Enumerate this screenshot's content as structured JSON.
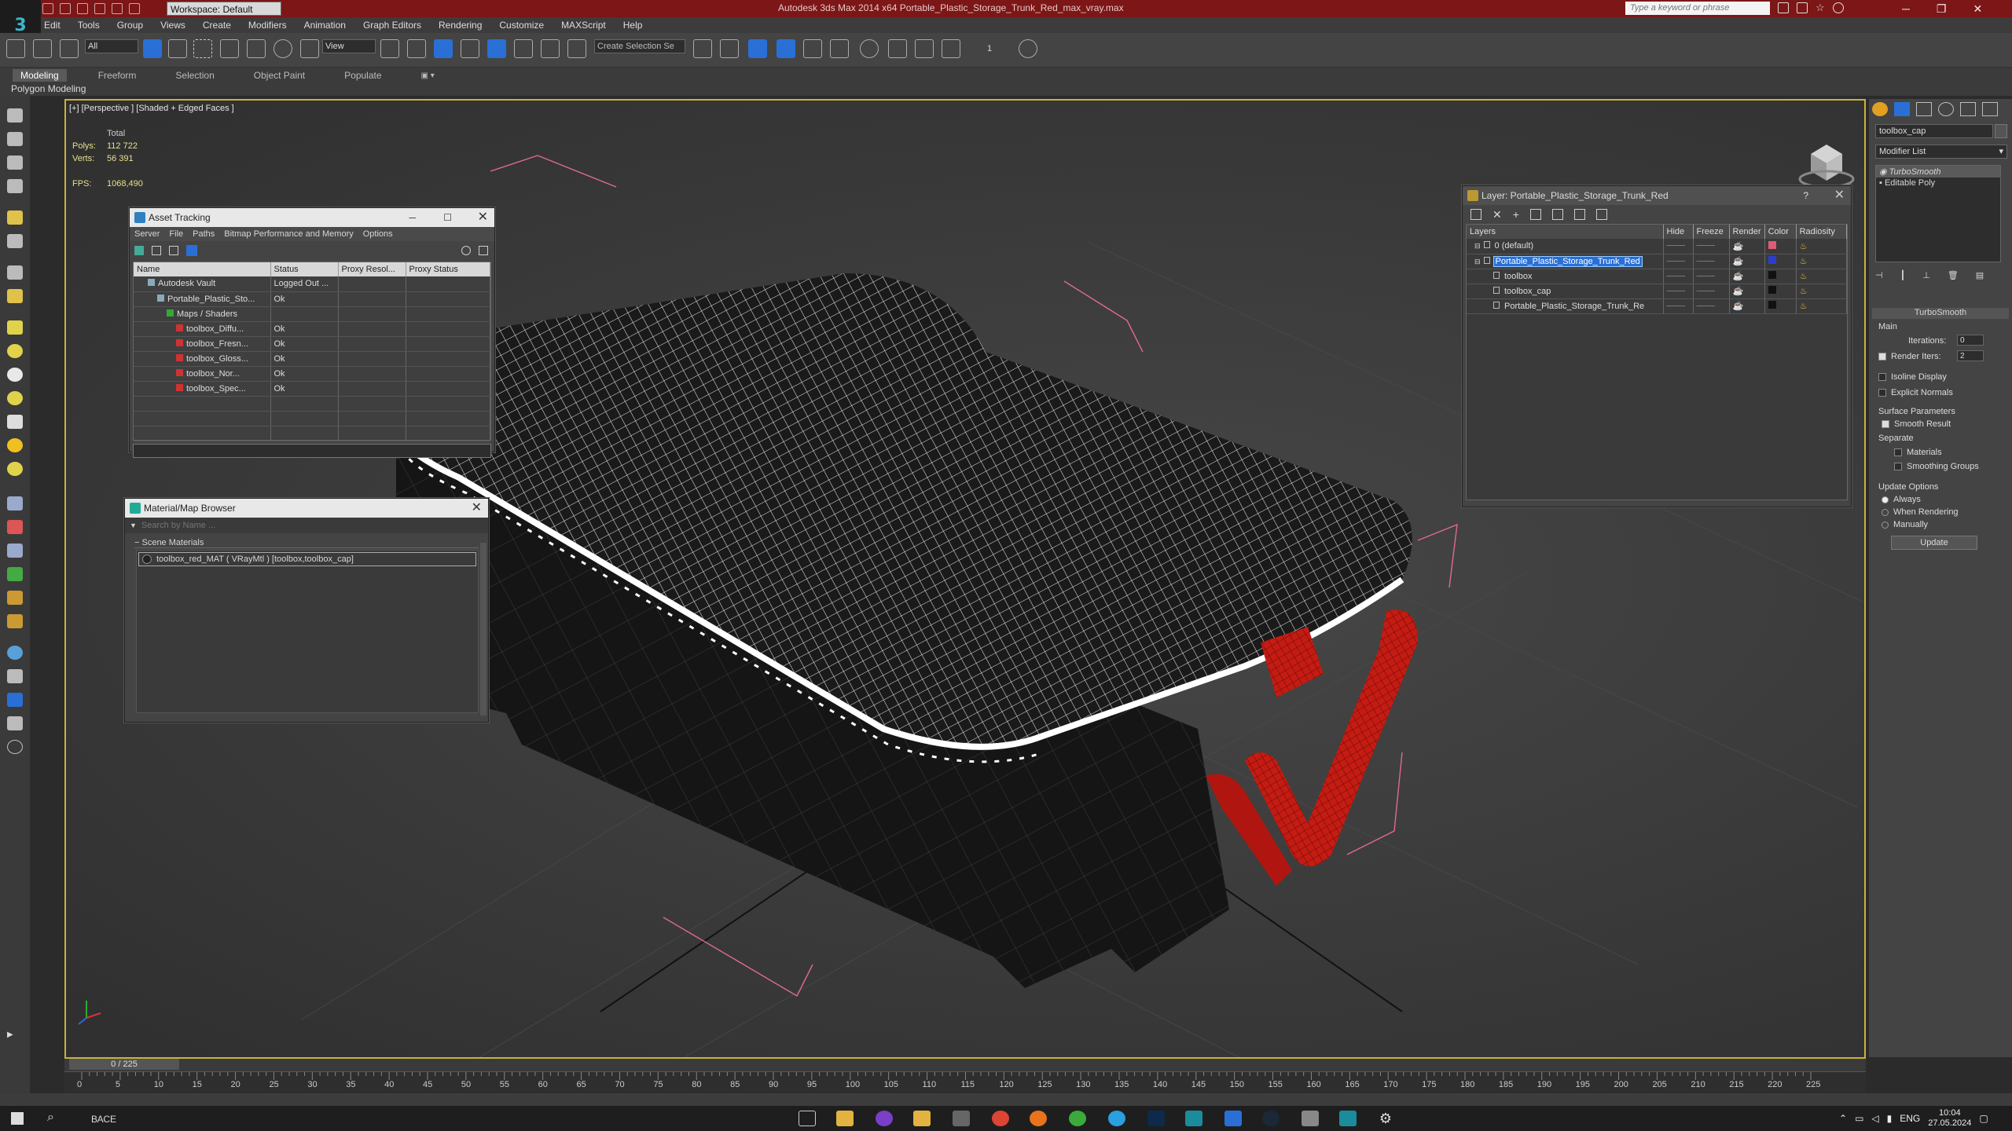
{
  "app": {
    "logo": "3",
    "window_title": "Autodesk 3ds Max 2014 x64     Portable_Plastic_Storage_Trunk_Red_max_vray.max",
    "workspace": "Workspace: Default",
    "search_placeholder": "Type a keyword or phrase"
  },
  "menu": [
    "Edit",
    "Tools",
    "Group",
    "Views",
    "Create",
    "Modifiers",
    "Animation",
    "Graph Editors",
    "Rendering",
    "Customize",
    "MAXScript",
    "Help"
  ],
  "toolbar": {
    "selection_filter": "All",
    "ref_coord": "View",
    "named_selection": "Create Selection Se",
    "spinner_snap": "1"
  },
  "ribbon": {
    "tabs": [
      "Modeling",
      "Freeform",
      "Selection",
      "Object Paint",
      "Populate"
    ],
    "sub_label": "Polygon Modeling"
  },
  "viewport": {
    "label": "[+] [Perspective ] [Shaded + Edged Faces ]",
    "stats_header": "Total",
    "polys_label": "Polys:",
    "polys": "112 722",
    "verts_label": "Verts:",
    "verts": "56 391",
    "fps_label": "FPS:",
    "fps": "1068,490"
  },
  "asset_tracking": {
    "title": "Asset Tracking",
    "menu": [
      "Server",
      "File",
      "Paths",
      "Bitmap Performance and Memory",
      "Options"
    ],
    "columns": [
      "Name",
      "Status",
      "Proxy Resol...",
      "Proxy Status"
    ],
    "rows": [
      {
        "name": "Autodesk Vault",
        "status": "Logged Out ...",
        "indent": 0
      },
      {
        "name": "Portable_Plastic_Sto...",
        "status": "Ok",
        "indent": 1
      },
      {
        "name": "Maps / Shaders",
        "status": "",
        "indent": 2
      },
      {
        "name": "toolbox_Diffu...",
        "status": "Ok",
        "indent": 3
      },
      {
        "name": "toolbox_Fresn...",
        "status": "Ok",
        "indent": 3
      },
      {
        "name": "toolbox_Gloss...",
        "status": "Ok",
        "indent": 3
      },
      {
        "name": "toolbox_Nor...",
        "status": "Ok",
        "indent": 3
      },
      {
        "name": "toolbox_Spec...",
        "status": "Ok",
        "indent": 3
      }
    ]
  },
  "material_browser": {
    "title": "Material/Map Browser",
    "search_placeholder": "Search by Name ...",
    "section": "Scene Materials",
    "item": "toolbox_red_MAT ( VRayMtl ) [toolbox,toolbox_cap]"
  },
  "layer_manager": {
    "title": "Layer: Portable_Plastic_Storage_Trunk_Red",
    "columns": [
      "Layers",
      "Hide",
      "Freeze",
      "Render",
      "Color",
      "Radiosity"
    ],
    "rows": [
      {
        "name": "0 (default)",
        "indent": 0,
        "selected": false,
        "color": "#e05a7a"
      },
      {
        "name": "Portable_Plastic_Storage_Trunk_Red",
        "indent": 0,
        "selected": true,
        "color": "#2a3fd0"
      },
      {
        "name": "toolbox",
        "indent": 1,
        "selected": false,
        "color": "#111111"
      },
      {
        "name": "toolbox_cap",
        "indent": 1,
        "selected": false,
        "color": "#111111"
      },
      {
        "name": "Portable_Plastic_Storage_Trunk_Re",
        "indent": 1,
        "selected": false,
        "color": "#111111"
      }
    ]
  },
  "command_panel": {
    "object_name": "toolbox_cap",
    "modifier_list": "Modifier List",
    "stack": [
      "TurboSmooth",
      "Editable Poly"
    ],
    "rollout": "TurboSmooth",
    "main": "Main",
    "iterations_label": "Iterations:",
    "iterations": "0",
    "render_iters_label": "Render Iters:",
    "render_iters": "2",
    "isoline": "Isoline Display",
    "explicit_normals": "Explicit Normals",
    "surface_params": "Surface Parameters",
    "smooth_result": "Smooth Result",
    "separate": "Separate",
    "materials": "Materials",
    "smoothing_groups": "Smoothing Groups",
    "update_options": "Update Options",
    "always": "Always",
    "when_rendering": "When Rendering",
    "manually": "Manually",
    "update_button": "Update"
  },
  "timeline": {
    "frame_counter": "0 / 225",
    "ticks": [
      "0",
      "5",
      "10",
      "15",
      "20",
      "25",
      "30",
      "35",
      "40",
      "45",
      "50",
      "55",
      "60",
      "65",
      "70",
      "75",
      "80",
      "85",
      "90",
      "95",
      "100",
      "105",
      "110",
      "115",
      "120",
      "125",
      "130",
      "135",
      "140",
      "145",
      "150",
      "155",
      "160",
      "165",
      "170",
      "175",
      "180",
      "185",
      "190",
      "195",
      "200",
      "205",
      "210",
      "215",
      "220",
      "225"
    ]
  },
  "taskbar": {
    "search_text": "ВАСЕ",
    "lang": "ENG",
    "time": "10:04",
    "date": "27.05.2024"
  },
  "colors": {
    "title_bar": "#7d1616",
    "viewport_border": "#c9b23a",
    "selection_blue": "#2a6fd6",
    "toolbox_red": "#c41b12"
  }
}
